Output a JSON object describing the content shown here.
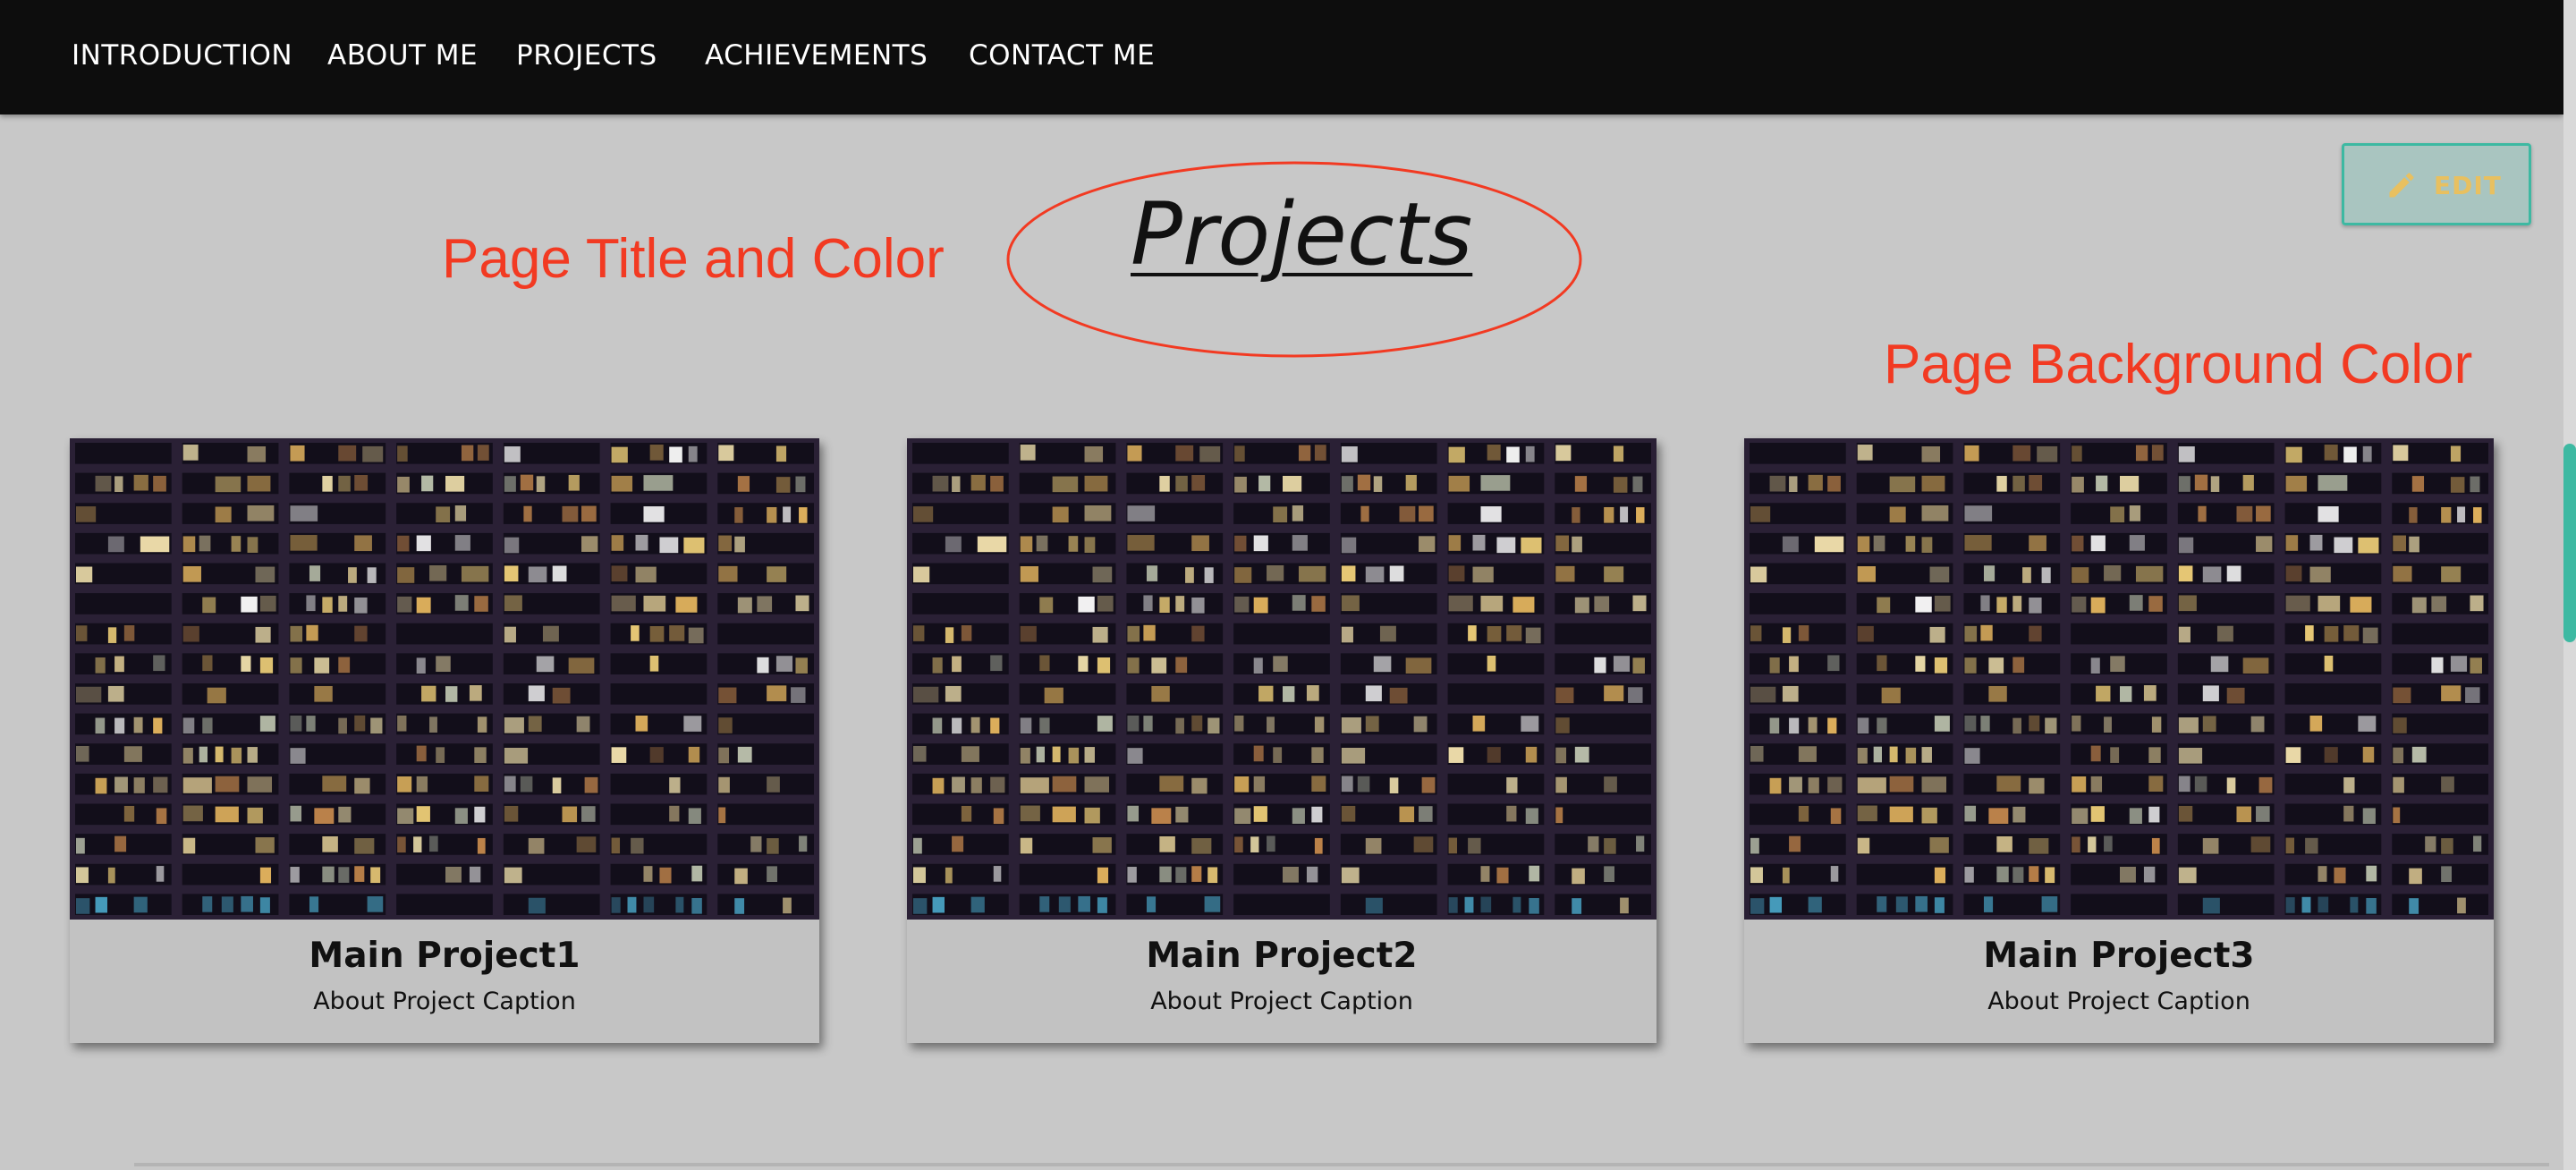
{
  "nav": {
    "items": [
      {
        "label": "INTRODUCTION"
      },
      {
        "label": "ABOUT ME"
      },
      {
        "label": "PROJECTS"
      },
      {
        "label": "ACHIEVEMENTS"
      },
      {
        "label": "CONTACT ME"
      }
    ]
  },
  "edit_button": {
    "label": "EDIT",
    "icon": "pencil-icon"
  },
  "page": {
    "title": "Projects",
    "background_color": "#c8c8c8"
  },
  "annotations": {
    "title_note": "Page Title and Color",
    "background_note": "Page Background Color",
    "color": "#f23a22"
  },
  "cards": [
    {
      "title": "Main Project1",
      "caption": "About Project Caption"
    },
    {
      "title": "Main Project2",
      "caption": "About Project Caption"
    },
    {
      "title": "Main Project3",
      "caption": "About Project Caption"
    }
  ],
  "colors": {
    "navbar": "#0d0d0d",
    "accent": "#3db9a2"
  }
}
